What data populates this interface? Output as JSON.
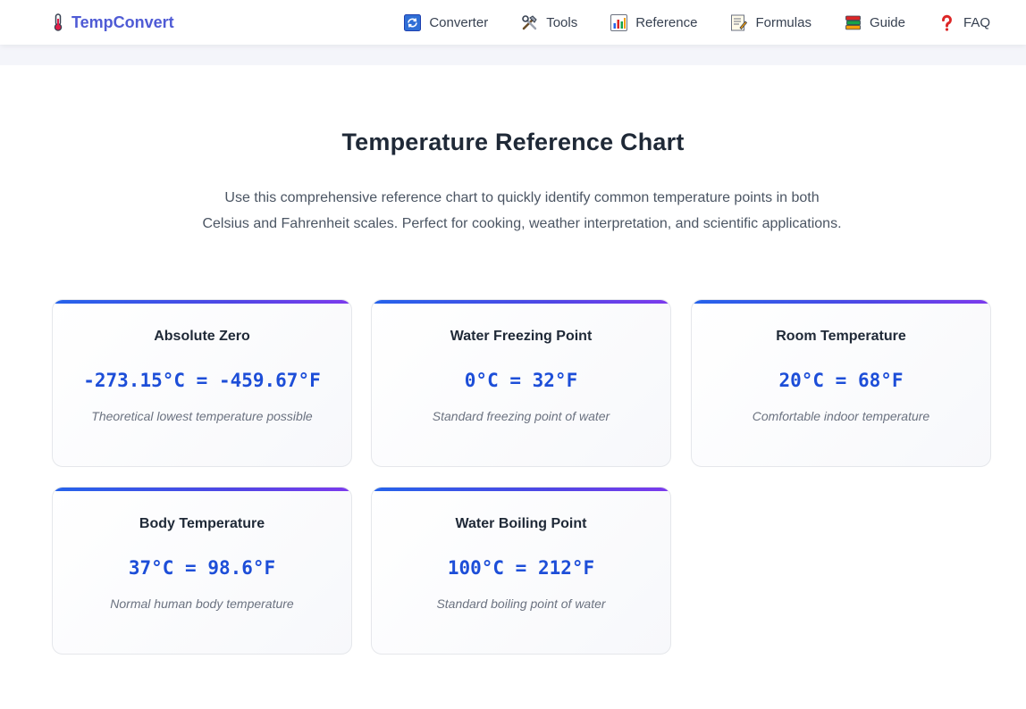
{
  "brand": {
    "name": "TempConvert",
    "icon": "thermometer-icon",
    "color": "#4f5bd5"
  },
  "nav": {
    "items": [
      {
        "label": "Converter",
        "icon": "refresh-icon"
      },
      {
        "label": "Tools",
        "icon": "tools-icon"
      },
      {
        "label": "Reference",
        "icon": "bar-chart-icon"
      },
      {
        "label": "Formulas",
        "icon": "memo-icon"
      },
      {
        "label": "Guide",
        "icon": "books-icon"
      },
      {
        "label": "FAQ",
        "icon": "question-mark-icon"
      }
    ]
  },
  "reference": {
    "title": "Temperature Reference Chart",
    "description": "Use this comprehensive reference chart to quickly identify common temperature points in both Celsius and Fahrenheit scales. Perfect for cooking, weather interpretation, and scientific applications.",
    "cards": [
      {
        "title": "Absolute Zero",
        "value": "-273.15°C = -459.67°F",
        "desc": "Theoretical lowest temperature possible"
      },
      {
        "title": "Water Freezing Point",
        "value": "0°C = 32°F",
        "desc": "Standard freezing point of water"
      },
      {
        "title": "Room Temperature",
        "value": "20°C = 68°F",
        "desc": "Comfortable indoor temperature"
      },
      {
        "title": "Body Temperature",
        "value": "37°C = 98.6°F",
        "desc": "Normal human body temperature"
      },
      {
        "title": "Water Boiling Point",
        "value": "100°C = 212°F",
        "desc": "Standard boiling point of water"
      }
    ]
  },
  "colors": {
    "accent_start": "#2563eb",
    "accent_end": "#7c3aed",
    "value_text": "#1d4ed8"
  }
}
